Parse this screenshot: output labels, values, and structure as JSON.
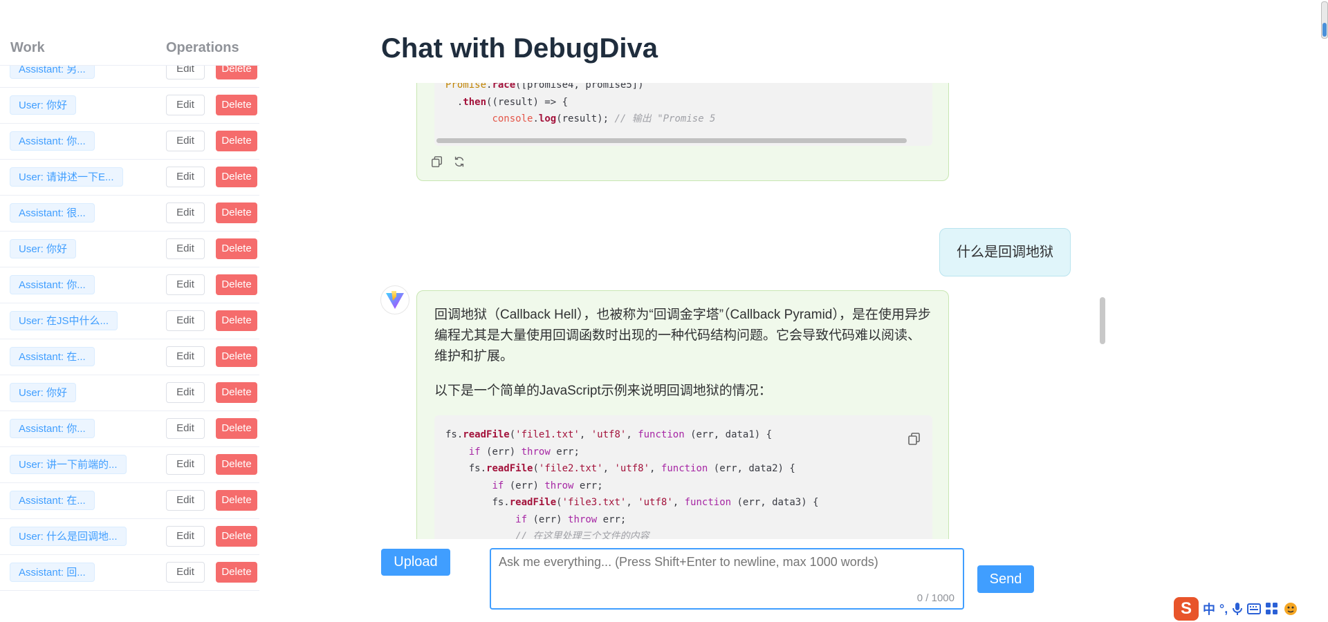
{
  "sidebar": {
    "col_work": "Work",
    "col_operations": "Operations",
    "edit_label": "Edit",
    "delete_label": "Delete",
    "items": [
      {
        "label": "Assistant: 另..."
      },
      {
        "label": "User: 你好"
      },
      {
        "label": "Assistant: 你..."
      },
      {
        "label": "User: 请讲述一下E..."
      },
      {
        "label": "Assistant: 很..."
      },
      {
        "label": "User: 你好"
      },
      {
        "label": "Assistant: 你..."
      },
      {
        "label": "User: 在JS中什么..."
      },
      {
        "label": "Assistant: 在..."
      },
      {
        "label": "User: 你好"
      },
      {
        "label": "Assistant: 你..."
      },
      {
        "label": "User: 讲一下前端的..."
      },
      {
        "label": "Assistant: 在..."
      },
      {
        "label": "User: 什么是回调地..."
      },
      {
        "label": "Assistant: 回..."
      }
    ]
  },
  "main": {
    "title": "Chat with DebugDiva",
    "messages": {
      "user_question": "什么是回调地狱",
      "assistant_para1": "回调地狱（Callback Hell），也被称为“回调金字塔”（Callback Pyramid），是在使用异步编程尤其是大量使用回调函数时出现的一种代码结构问题。它会导致代码难以阅读、维护和扩展。",
      "assistant_para2": "以下是一个简单的JavaScript示例来说明回调地狱的情况："
    },
    "code_top": {
      "line1_cls": "Promise",
      "line1_fn": "race",
      "line1_rest": "([promise4, promise5])",
      "line2_fn": "then",
      "line2_rest": "((result) => {",
      "line3_obj": "console",
      "line3_fn": "log",
      "line3_rest": "(result);",
      "line3_comment": "// 输出 \"Promise 5"
    },
    "code_bottom": {
      "fs": "fs.",
      "readFile": "readFile",
      "file1": "'file1.txt'",
      "file2": "'file2.txt'",
      "file3": "'file3.txt'",
      "utf8": "'utf8'",
      "function_kw": "function",
      "args1": "(err, data1) {",
      "args2": "(err, data2) {",
      "args3": "(err, data3) {",
      "if_kw": "if",
      "throw_kw": "throw",
      "err_cond": "(err)",
      "err_val": "err;",
      "comment": "// 在这里处理三个文件的内容"
    }
  },
  "composer": {
    "upload_label": "Upload",
    "placeholder": "Ask me everything... (Press Shift+Enter to newline, max 1000 words)",
    "counter": "0 / 1000",
    "send_label": "Send"
  },
  "ime": {
    "logo": "S",
    "lang": "中",
    "punct": "°,"
  },
  "colors": {
    "primary": "#409eff",
    "danger": "#f56c6c",
    "assistant_bubble": "#f0f9eb",
    "user_bubble": "#e0f5fa"
  }
}
